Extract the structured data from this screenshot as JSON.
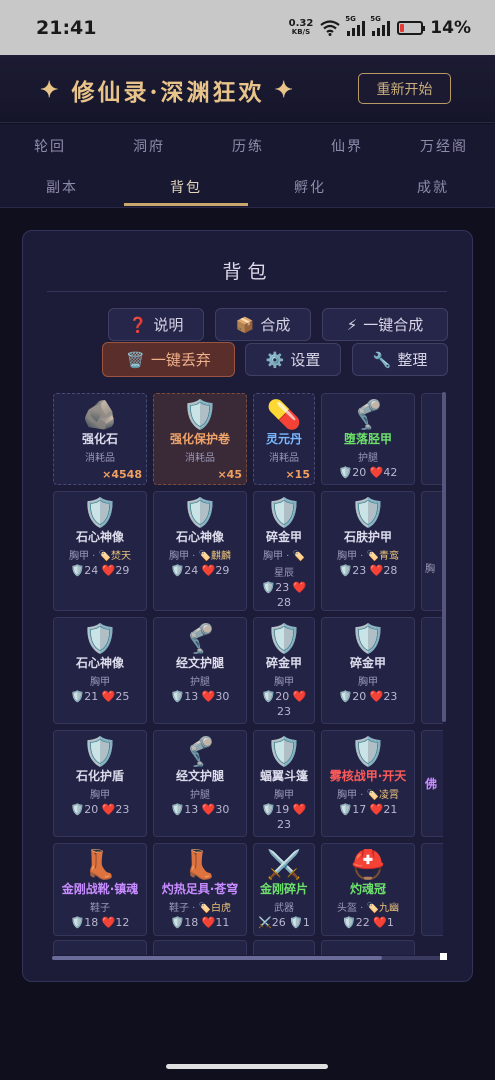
{
  "status": {
    "time": "21:41",
    "net_speed": "0.32",
    "net_unit": "KB/S",
    "sig1": "5G",
    "sig2": "5G",
    "battery": "14%"
  },
  "header": {
    "title": "修仙录·深渊狂欢",
    "star": "✦",
    "restart_label": "重新开始"
  },
  "tabs": {
    "row1": [
      "轮回",
      "洞府",
      "历练",
      "仙界",
      "万经阁"
    ],
    "row2": [
      "副本",
      "背包",
      "孵化",
      "成就"
    ],
    "active": "背包"
  },
  "panel": {
    "title": "背包",
    "buttons": {
      "help": {
        "icon": "❓",
        "label": "说明"
      },
      "craft": {
        "icon": "📦",
        "label": "合成"
      },
      "auto_craft": {
        "icon": "⚡",
        "label": "一键合成"
      },
      "discard": {
        "icon": "🗑️",
        "label": "一键丢弃"
      },
      "settings": {
        "icon": "⚙️",
        "label": "设置"
      },
      "sort": {
        "icon": "🔧",
        "label": "整理"
      }
    }
  },
  "items": [
    {
      "icon": "🪨",
      "name": "强化石",
      "sub": "消耗品",
      "qty": "×4548",
      "color": "",
      "style": "dash"
    },
    {
      "icon": "🛡️",
      "name": "强化保护卷",
      "sub": "消耗品",
      "qty": "×45",
      "color": "orange",
      "style": "orange"
    },
    {
      "icon": "💊",
      "name": "灵元丹",
      "sub": "消耗品",
      "qty": "×15",
      "color": "blue",
      "style": "dash"
    },
    {
      "icon": "🦿",
      "name": "堕落胫甲",
      "sub": "护腿",
      "stats": "🛡️20 ❤️42",
      "color": "green"
    },
    {
      "icon": "🛡️",
      "name": "石心神像",
      "sub": "胸甲 · ",
      "tag": "🏷️焚天",
      "stats": "🛡️24 ❤️29",
      "color": ""
    },
    {
      "icon": "🛡️",
      "name": "石心神像",
      "sub": "胸甲 · ",
      "tag": "🏷️麒麟",
      "stats": "🛡️24 ❤️29",
      "color": ""
    },
    {
      "icon": "🛡️",
      "name": "碎金甲",
      "sub": "胸甲 · ",
      "tag": "🏷️",
      "sub2": "星辰",
      "stats": "🛡️23 ❤️ 28",
      "color": ""
    },
    {
      "icon": "🛡️",
      "name": "石肤护甲",
      "sub": "胸甲 · ",
      "tag": "🏷️青鸾",
      "stats": "🛡️23 ❤️28",
      "color": ""
    },
    {
      "icon": "🛡️",
      "name": "石心神像",
      "sub": "胸甲",
      "stats": "🛡️21 ❤️25",
      "color": ""
    },
    {
      "icon": "🦿",
      "name": "经文护腿",
      "sub": "护腿",
      "stats": "🛡️13 ❤️30",
      "color": ""
    },
    {
      "icon": "🛡️",
      "name": "碎金甲",
      "sub": "胸甲",
      "stats": "🛡️20 ❤️ 23",
      "color": ""
    },
    {
      "icon": "🛡️",
      "name": "碎金甲",
      "sub": "胸甲",
      "stats": "🛡️20 ❤️23",
      "color": ""
    },
    {
      "icon": "🛡️",
      "name": "石化护盾",
      "sub": "胸甲",
      "stats": "🛡️20 ❤️23",
      "color": ""
    },
    {
      "icon": "🦿",
      "name": "经文护腿",
      "sub": "护腿",
      "stats": "🛡️13 ❤️30",
      "color": ""
    },
    {
      "icon": "🛡️",
      "name": "蝠翼斗篷",
      "sub": "胸甲",
      "stats": "🛡️19 ❤️ 23",
      "color": ""
    },
    {
      "icon": "🛡️",
      "name": "雾核战甲·开天",
      "sub": "胸甲 · ",
      "tag": "🏷️凌霄",
      "stats": "🛡️17 ❤️21",
      "color": "red"
    },
    {
      "icon": "👢",
      "name": "金刚战靴·镇魂",
      "sub": "鞋子",
      "stats": "🛡️18 ❤️12",
      "color": "purple"
    },
    {
      "icon": "👢",
      "name": "灼热足具·苍穹",
      "sub": "鞋子 · ",
      "tag": "🏷️白虎",
      "stats": "🛡️18 ❤️11",
      "color": "purple"
    },
    {
      "icon": "⚔️",
      "name": "金刚碎片",
      "sub": "武器",
      "stats": "⚔️26 🛡️1",
      "color": "green"
    },
    {
      "icon": "⛑️",
      "name": "灼魂冠",
      "sub": "头盔 · ",
      "tag": "🏷️九幽",
      "stats": "🛡️22 ❤️1",
      "color": "green"
    }
  ],
  "edge_items": [
    "胸",
    "佛"
  ]
}
